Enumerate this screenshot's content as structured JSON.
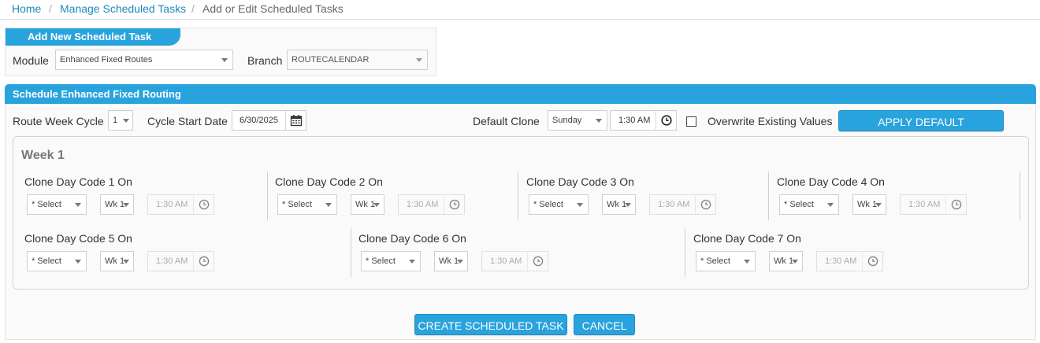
{
  "breadcrumb": {
    "home": "Home",
    "manage": "Manage Scheduled Tasks",
    "current": "Add or Edit Scheduled Tasks",
    "separator": "/"
  },
  "add_task": {
    "header": "Add New Scheduled Task",
    "module_label": "Module",
    "module_value": "Enhanced Fixed Routes",
    "branch_label": "Branch",
    "branch_value": "ROUTECALENDAR"
  },
  "schedule": {
    "header": "Schedule Enhanced Fixed Routing",
    "route_week_cycle_label": "Route Week Cycle",
    "route_week_cycle_value": "1",
    "cycle_start_label": "Cycle Start Date",
    "cycle_start_value": "6/30/2025",
    "default_clone_label": "Default Clone",
    "default_clone_day": "Sunday",
    "default_clone_time": "1:30 AM",
    "overwrite_label": "Overwrite Existing Values",
    "apply_default_label": "APPLY DEFAULT"
  },
  "week": {
    "title": "Week 1",
    "clone_days": [
      {
        "label": "Clone Day Code 1 On",
        "day": "* Select",
        "week": "Wk 1",
        "time": "1:30 AM"
      },
      {
        "label": "Clone Day Code 2 On",
        "day": "* Select",
        "week": "Wk 1",
        "time": "1:30 AM"
      },
      {
        "label": "Clone Day Code 3 On",
        "day": "* Select",
        "week": "Wk 1",
        "time": "1:30 AM"
      },
      {
        "label": "Clone Day Code 4 On",
        "day": "* Select",
        "week": "Wk 1",
        "time": "1:30 AM"
      },
      {
        "label": "Clone Day Code 5 On",
        "day": "* Select",
        "week": "Wk 1",
        "time": "1:30 AM"
      },
      {
        "label": "Clone Day Code 6 On",
        "day": "* Select",
        "week": "Wk 1",
        "time": "1:30 AM"
      },
      {
        "label": "Clone Day Code 7 On",
        "day": "* Select",
        "week": "Wk 1",
        "time": "1:30 AM"
      }
    ]
  },
  "actions": {
    "create_label": "CREATE SCHEDULED TASK",
    "cancel_label": "CANCEL"
  },
  "colors": {
    "accent": "#29a3dd",
    "link": "#1e88b8"
  },
  "icons": [
    "calendar-icon",
    "clock-icon",
    "chevron-down-icon"
  ]
}
